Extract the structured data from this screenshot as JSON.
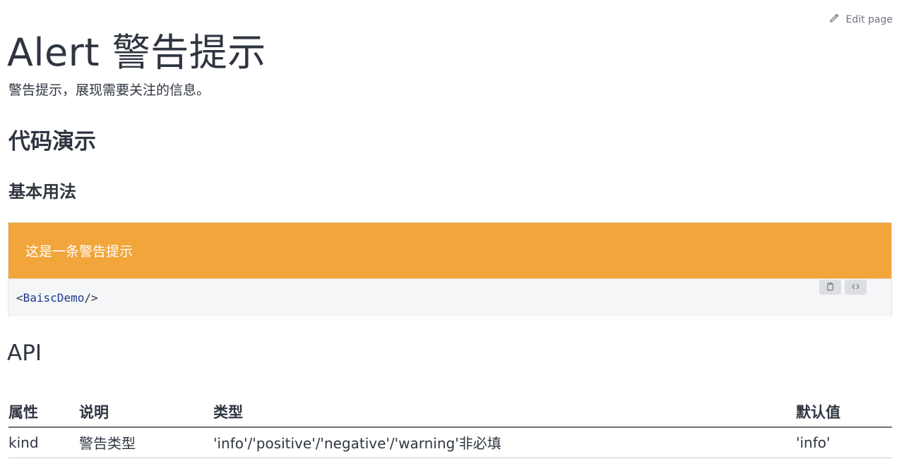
{
  "edit": {
    "label": "Edit page",
    "icon": "pencil-icon"
  },
  "title": "Alert 警告提示",
  "description": "警告提示，展现需要关注的信息。",
  "sections": {
    "demo_heading": "代码演示",
    "basic_heading": "基本用法",
    "api_heading": "API"
  },
  "demo": {
    "alert_text": "这是一条警告提示",
    "alert_color": "#f2a53b",
    "code_open": "<",
    "code_tag": "BaiscDemo",
    "code_close": " />",
    "copy_icon": "clipboard-icon",
    "toggle_icon": "code-icon"
  },
  "api_table": {
    "headers": [
      "属性",
      "说明",
      "类型",
      "默认值"
    ],
    "rows": [
      [
        "kind",
        "警告类型",
        "'info'/'positive'/'negative'/'warning'非必填",
        "'info'"
      ]
    ]
  }
}
